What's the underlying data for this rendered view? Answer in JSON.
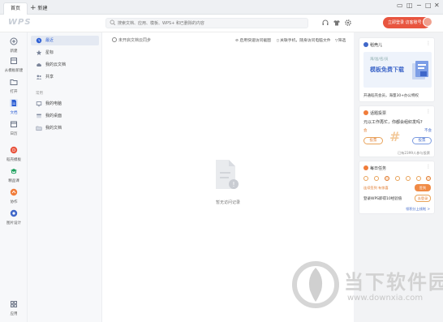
{
  "titlebar": {
    "tab_home": "首页",
    "tab_new": "新建",
    "controls": [
      "☐",
      "▢",
      "−",
      "□",
      "✕"
    ]
  },
  "toolbar": {
    "logo": "WPS",
    "search_placeholder": "搜索文档、应用、模板、WPS+ 和已删除的内容",
    "login_label": "立即登录 访客账号"
  },
  "rail": [
    {
      "label": "新建",
      "icon": "plus-circle-icon"
    },
    {
      "label": "从模板新建",
      "icon": "template-icon"
    },
    {
      "label": "打开",
      "icon": "folder-icon"
    },
    {
      "label": "文档",
      "icon": "document-icon",
      "active": true
    },
    {
      "label": "日历",
      "icon": "calendar-icon"
    },
    {
      "label": "稻壳模板",
      "icon": "docer-icon"
    },
    {
      "label": "精品课",
      "icon": "course-icon"
    },
    {
      "label": "协作",
      "icon": "share-icon"
    },
    {
      "label": "图片设计",
      "icon": "design-icon"
    },
    {
      "label": "应用",
      "icon": "apps-icon"
    }
  ],
  "sidebar": {
    "items": [
      {
        "label": "最近",
        "icon": "clock-icon",
        "active": true
      },
      {
        "label": "星标",
        "icon": "star-icon"
      },
      {
        "label": "我的云文档",
        "icon": "cloud-icon"
      },
      {
        "label": "共享",
        "icon": "people-icon"
      }
    ],
    "section": "常用",
    "section_items": [
      {
        "label": "我的电脑",
        "icon": "computer-icon"
      },
      {
        "label": "我的桌面",
        "icon": "desktop-icon"
      },
      {
        "label": "我的文档",
        "icon": "mydocs-icon"
      }
    ]
  },
  "main": {
    "sync_text": "未开启文档云同步",
    "actions": [
      "启用快速访问截图",
      "关联手机，随身访问电脑文件",
      "筛选"
    ],
    "empty_text": "暂无访问记录"
  },
  "right": {
    "template_card": {
      "title": "稻壳儿",
      "banner_sub": "海/准/名/员",
      "banner_main": "模板免费下载",
      "text": "开通稻壳会员，海量30+办公特权"
    },
    "invite_card": {
      "title": "话题投票",
      "question": "元以工作再忙，你都会组织发吗?",
      "left_label": "会",
      "right_label": "不会",
      "left_btn": "投票",
      "right_btn": "投票",
      "count": "已有2399人参与投票"
    },
    "daily_card": {
      "title": "每日任务",
      "note": "连续签到 有惊喜",
      "btn1": "签到",
      "task": "登录WPS即得10经验值",
      "btn2": "去登录",
      "link": "领积分上线啦 >"
    }
  },
  "watermark": {
    "title": "当下软件园",
    "url": "www.downxia.com"
  }
}
